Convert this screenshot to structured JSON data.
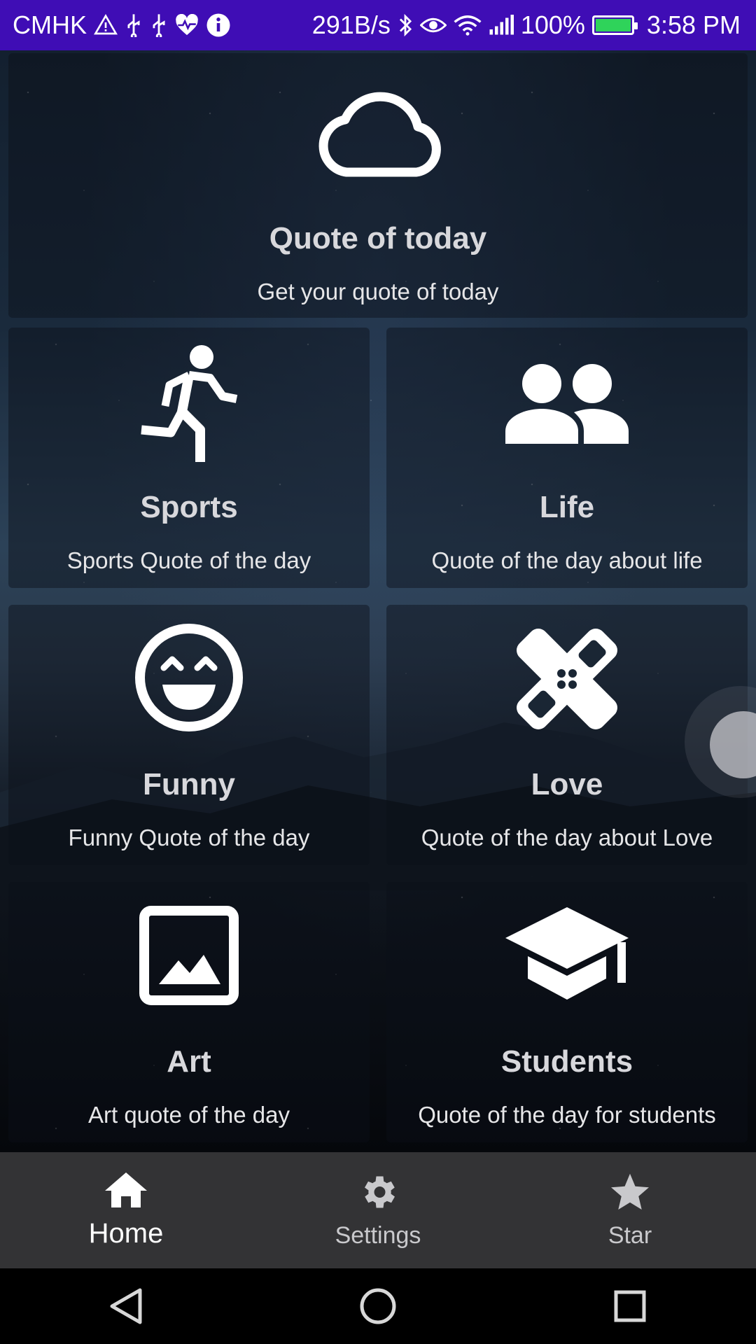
{
  "status_bar": {
    "carrier": "CMHK",
    "net_speed": "291B/s",
    "battery": "100%",
    "time": "3:58 PM"
  },
  "cards": {
    "today": {
      "title": "Quote of today",
      "subtitle": "Get your quote of today",
      "icon": "cloud-icon"
    },
    "sports": {
      "title": "Sports",
      "subtitle": "Sports Quote of the day",
      "icon": "running-person-icon"
    },
    "life": {
      "title": "Life",
      "subtitle": "Quote of the day about life",
      "icon": "people-icon"
    },
    "funny": {
      "title": "Funny",
      "subtitle": "Funny Quote of the day",
      "icon": "smiley-icon"
    },
    "love": {
      "title": "Love",
      "subtitle": "Quote of the day about Love",
      "icon": "bandage-icon"
    },
    "art": {
      "title": "Art",
      "subtitle": "Art quote of the day",
      "icon": "image-icon"
    },
    "students": {
      "title": "Students",
      "subtitle": "Quote of the day for students",
      "icon": "graduation-cap-icon"
    }
  },
  "bottom_nav": {
    "items": [
      {
        "label": "Home",
        "icon": "home-icon",
        "active": true
      },
      {
        "label": "Settings",
        "icon": "gear-icon",
        "active": false
      },
      {
        "label": "Star",
        "icon": "star-icon",
        "active": false
      }
    ]
  },
  "colors": {
    "status_bar": "#3F0DB5",
    "bottom_nav": "#333335",
    "battery_fill": "#2FD35A"
  }
}
